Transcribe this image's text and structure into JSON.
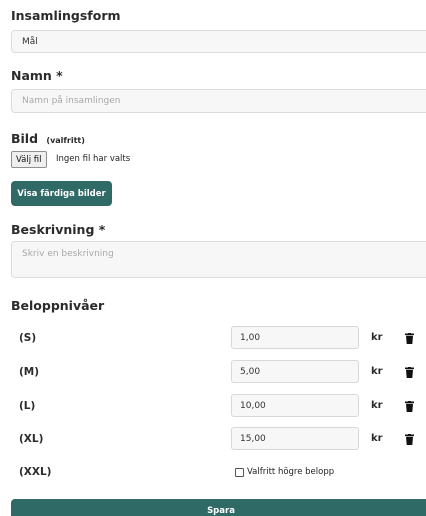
{
  "form": {
    "collection_form_label": "Insamlingsform",
    "collection_form_value": "Mål",
    "name_label": "Namn *",
    "name_placeholder": "Namn på insamlingen",
    "image_label": "Bild",
    "image_optional": "(valfritt)",
    "file_button": "Välj fil",
    "file_status": "Ingen fil har valts",
    "show_images_button": "Visa färdiga bilder",
    "description_label": "Beskrivning *",
    "description_placeholder": "Skriv en beskrivning",
    "amount_levels_label": "Beloppnivåer",
    "currency": "kr",
    "levels": [
      {
        "label": "(S)",
        "value": "1,00"
      },
      {
        "label": "(M)",
        "value": "5,00"
      },
      {
        "label": "(L)",
        "value": "10,00"
      },
      {
        "label": "(XL)",
        "value": "15,00"
      },
      {
        "label": "(XXL)"
      }
    ],
    "optional_higher_amount": "Valfritt högre belopp",
    "save_button": "Spara"
  }
}
